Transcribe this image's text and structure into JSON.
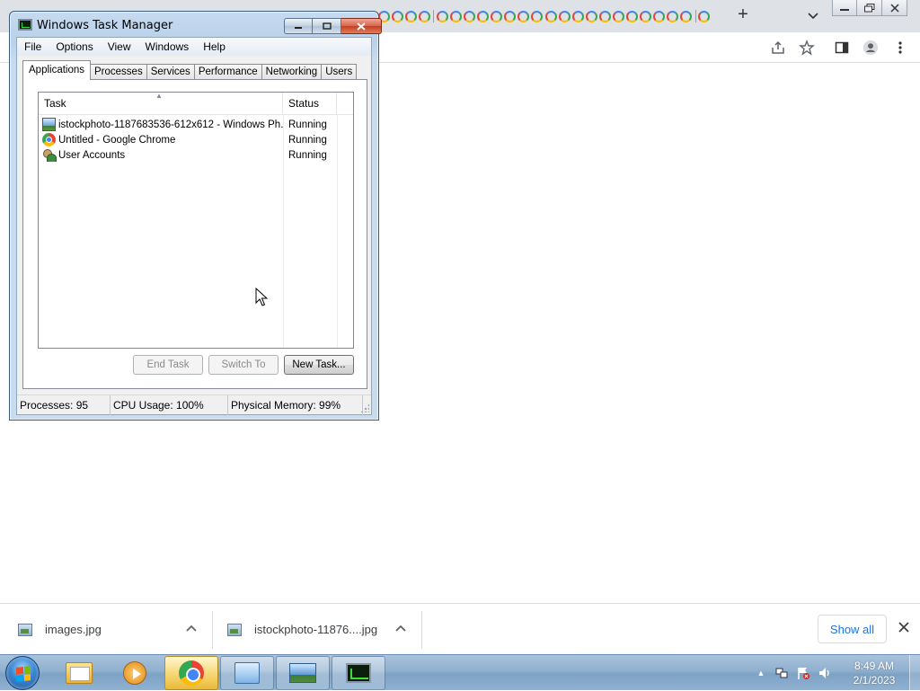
{
  "browser": {
    "new_tab_symbol": "+",
    "tab_favicons": [
      "g",
      "g",
      "g",
      "g",
      "sep",
      "g",
      "g",
      "g",
      "g",
      "g",
      "g",
      "g",
      "g",
      "g",
      "g",
      "g",
      "g",
      "g",
      "g",
      "g",
      "g",
      "g",
      "g",
      "g",
      "sep",
      "g"
    ],
    "icons": [
      "share-icon",
      "bookmark-star-icon",
      "side-panel-icon",
      "profile-icon",
      "more-menu-icon"
    ]
  },
  "task_manager": {
    "title": "Windows Task Manager",
    "menu": [
      "File",
      "Options",
      "View",
      "Windows",
      "Help"
    ],
    "tabs": [
      "Applications",
      "Processes",
      "Services",
      "Performance",
      "Networking",
      "Users"
    ],
    "active_tab": "Applications",
    "columns": {
      "task": "Task",
      "status": "Status"
    },
    "rows": [
      {
        "task": "istockphoto-1187683536-612x612 - Windows Ph...",
        "status": "Running",
        "icon": "photo-viewer-icon"
      },
      {
        "task": "Untitled - Google Chrome",
        "status": "Running",
        "icon": "chrome-icon"
      },
      {
        "task": "User Accounts",
        "status": "Running",
        "icon": "user-accounts-icon"
      }
    ],
    "buttons": {
      "end_task": "End Task",
      "switch_to": "Switch To",
      "new_task": "New Task..."
    },
    "status_bar": {
      "processes": "Processes: 95",
      "cpu": "CPU Usage: 100%",
      "memory": "Physical Memory: 99%"
    }
  },
  "downloads": {
    "items": [
      {
        "name": "images.jpg"
      },
      {
        "name": "istockphoto-11876....jpg"
      }
    ],
    "show_all": "Show all"
  },
  "taskbar": {
    "pinned": [
      "windows-explorer-icon",
      "media-player-icon",
      "chrome-icon",
      "control-panel-icon",
      "photo-viewer-icon",
      "task-manager-icon"
    ],
    "clock": {
      "time": "8:49 AM",
      "date": "2/1/2023"
    }
  }
}
